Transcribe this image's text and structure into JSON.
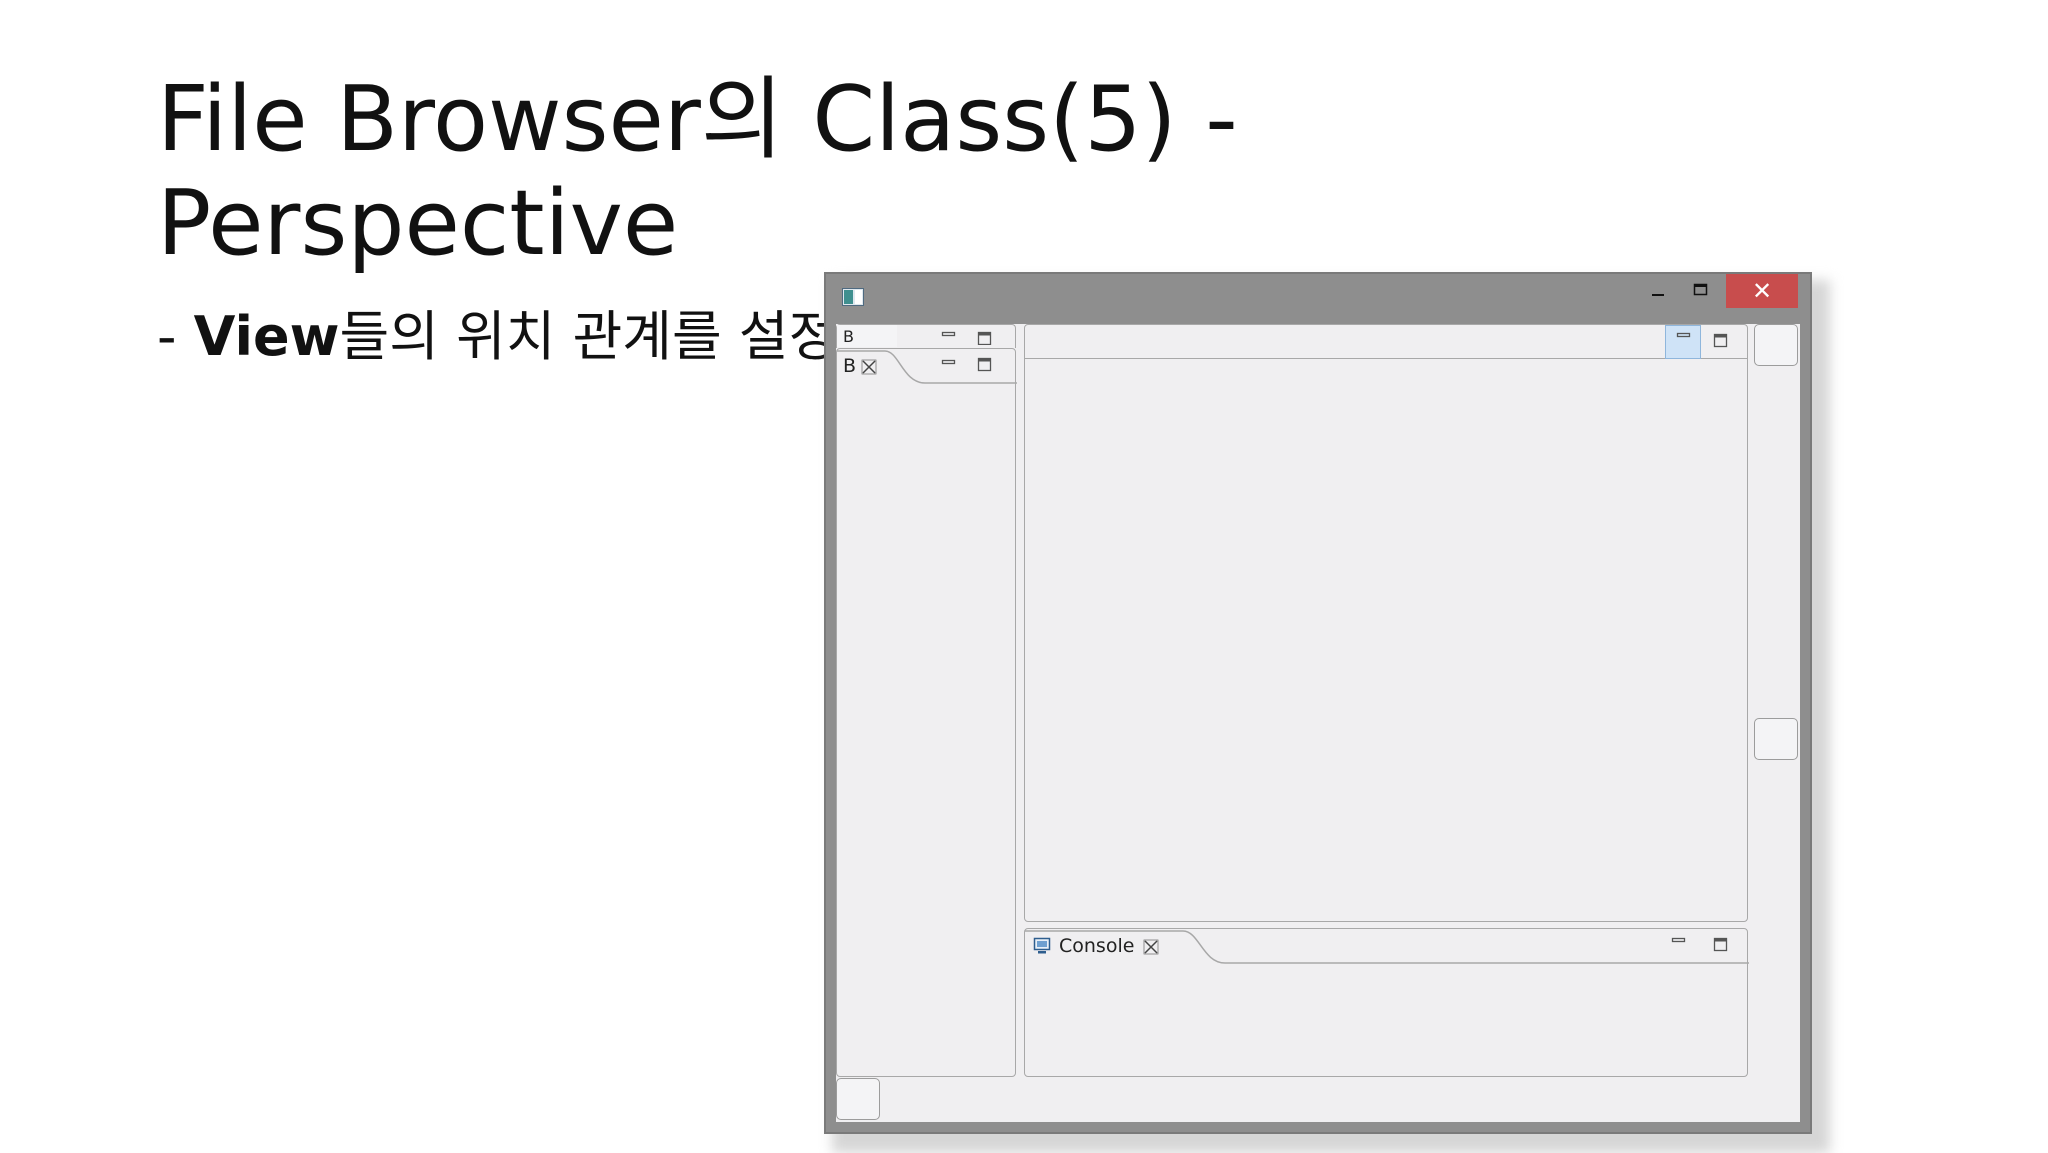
{
  "slide": {
    "title_line1": "File Browser의 Class(5) -",
    "title_line2": "Perspective",
    "bullet_prefix": "- ",
    "bullet_bold": "View",
    "bullet_rest": "들의 위치 관계를 설정"
  },
  "window": {
    "close_glyph": "✕",
    "left_tab_back_label": "B",
    "left_tab_front_label": "B",
    "console_tab_label": "Console"
  },
  "icons": {
    "app": "window-icon",
    "minimize": "minimize-icon",
    "maximize": "maximize-icon",
    "close": "close-icon",
    "tab_close": "tab-close-icon",
    "console": "console-icon"
  },
  "colors": {
    "window_frame": "#8e8e8e",
    "close_button": "#c84d4d",
    "panel_bg": "#f0eff1",
    "active_toggle": "#cfe3f7"
  }
}
